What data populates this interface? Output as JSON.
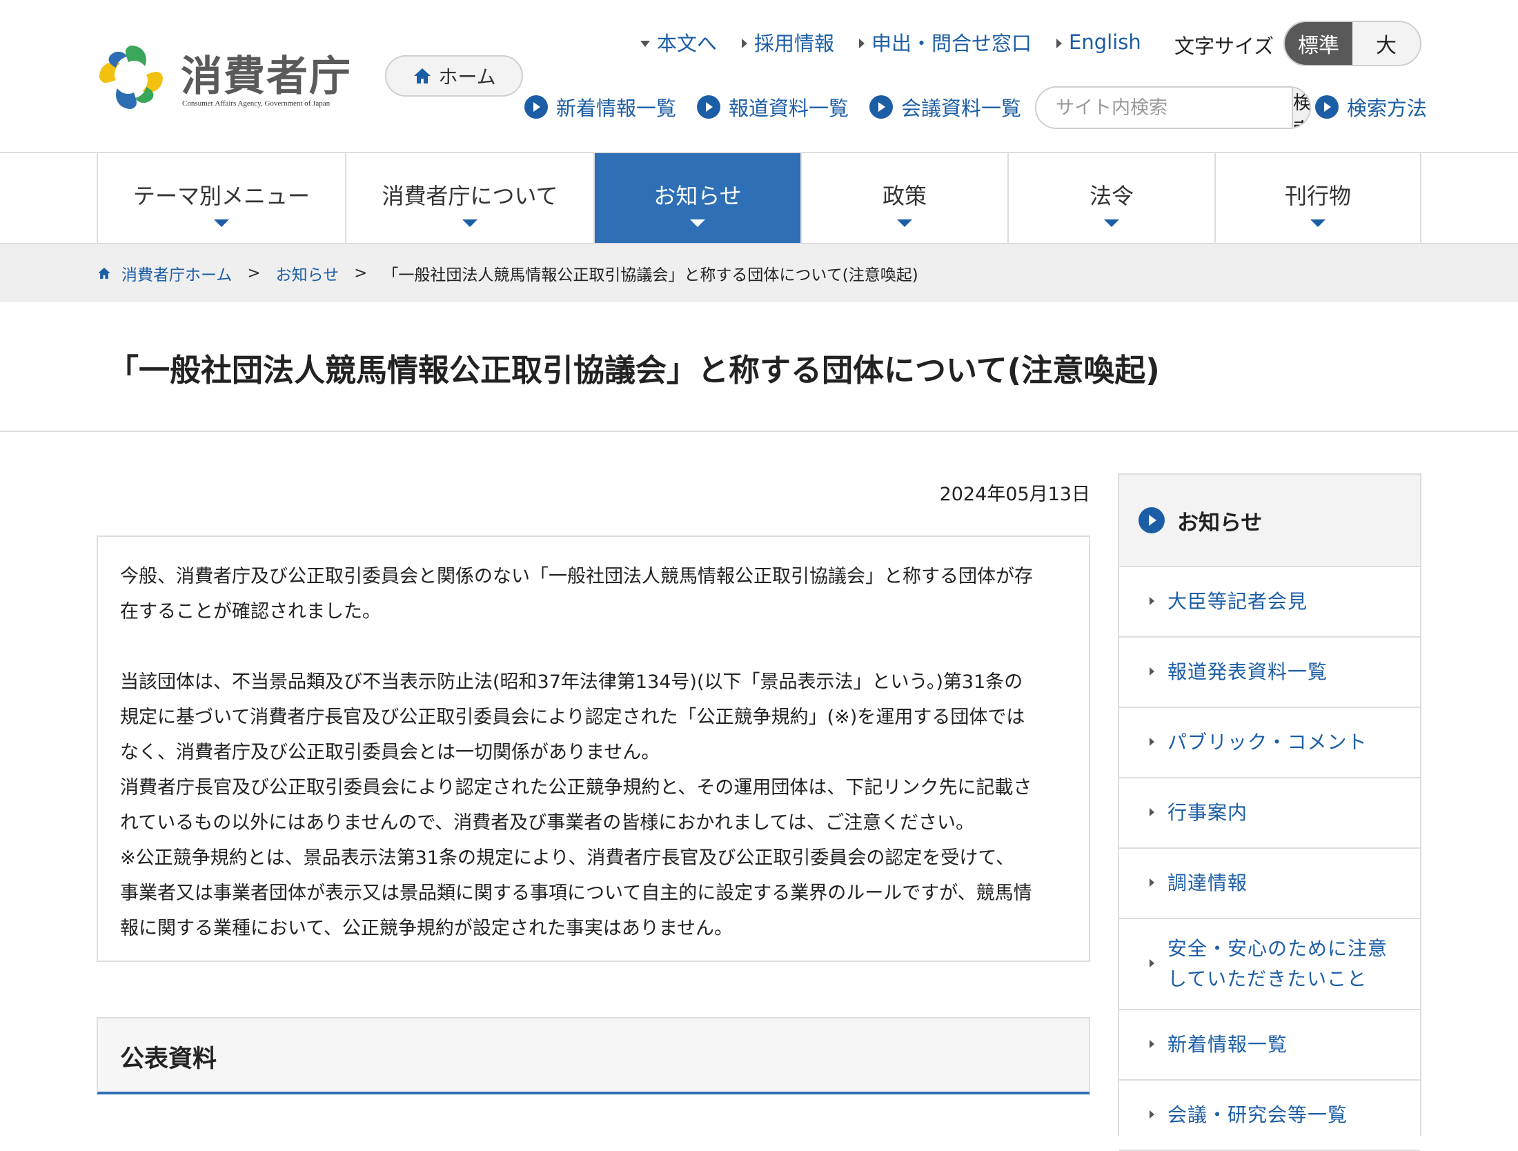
{
  "header": {
    "logo_text": "消費者庁",
    "logo_sub": "Consumer Affairs Agency, Government of Japan",
    "home_label": "ホーム",
    "top_links": [
      "本文へ",
      "採用情報",
      "申出・問合せ窓口",
      "English"
    ],
    "font_size_label": "文字サイズ",
    "font_size_options": [
      "標準",
      "大"
    ],
    "font_size_selected": "標準",
    "second_links": [
      "新着情報一覧",
      "報道資料一覧",
      "会議資料一覧"
    ],
    "search_placeholder": "サイト内検索",
    "search_button": "検索",
    "search_help": "検索方法"
  },
  "gnav": {
    "items": [
      "テーマ別メニュー",
      "消費者庁について",
      "お知らせ",
      "政策",
      "法令",
      "刊行物"
    ],
    "active": "お知らせ"
  },
  "breadcrumb": {
    "home": "消費者庁ホーム",
    "section": "お知らせ",
    "separator": ">",
    "current": "「一般社団法人競馬情報公正取引協議会」と称する団体について(注意喚起)"
  },
  "page": {
    "title": "「一般社団法人競馬情報公正取引協議会」と称する団体について(注意喚起)",
    "date": "2024年05月13日",
    "para1": "今般、消費者庁及び公正取引委員会と関係のない「一般社団法人競馬情報公正取引協議会」と称する団体が存\n在することが確認されました。",
    "para2": "当該団体は、不当景品類及び不当表示防止法(昭和37年法律第134号)(以下「景品表示法」という。)第31条の\n規定に基づいて消費者庁長官及び公正取引委員会により認定された「公正競争規約」(※)を運用する団体では\nなく、消費者庁及び公正取引委員会とは一切関係がありません。\n消費者庁長官及び公正取引委員会により認定された公正競争規約と、その運用団体は、下記リンク先に記載さ\nれているもの以外にはありませんので、消費者及び事業者の皆様におかれましては、ご注意ください。\n※公正競争規約とは、景品表示法第31条の規定により、消費者庁長官及び公正取引委員会の認定を受けて、\n事業者又は事業者団体が表示又は景品類に関する事項について自主的に設定する業界のルールですが、競馬情\n報に関する業種において、公正競争規約が設定された事実はありません。",
    "published_heading": "公表資料"
  },
  "sidebar": {
    "heading": "お知らせ",
    "items": [
      "大臣等記者会見",
      "報道発表資料一覧",
      "パブリック・コメント",
      "行事案内",
      "調達情報",
      "安全・安心のために注意していただきたいこと",
      "新着情報一覧",
      "会議・研究会等一覧"
    ]
  },
  "colors": {
    "link": "#1c5ea6",
    "nav_active": "#2e6fb5",
    "logo_green": "#3aa65a",
    "logo_yellow": "#f2c00e",
    "logo_blue": "#2d6db3"
  }
}
